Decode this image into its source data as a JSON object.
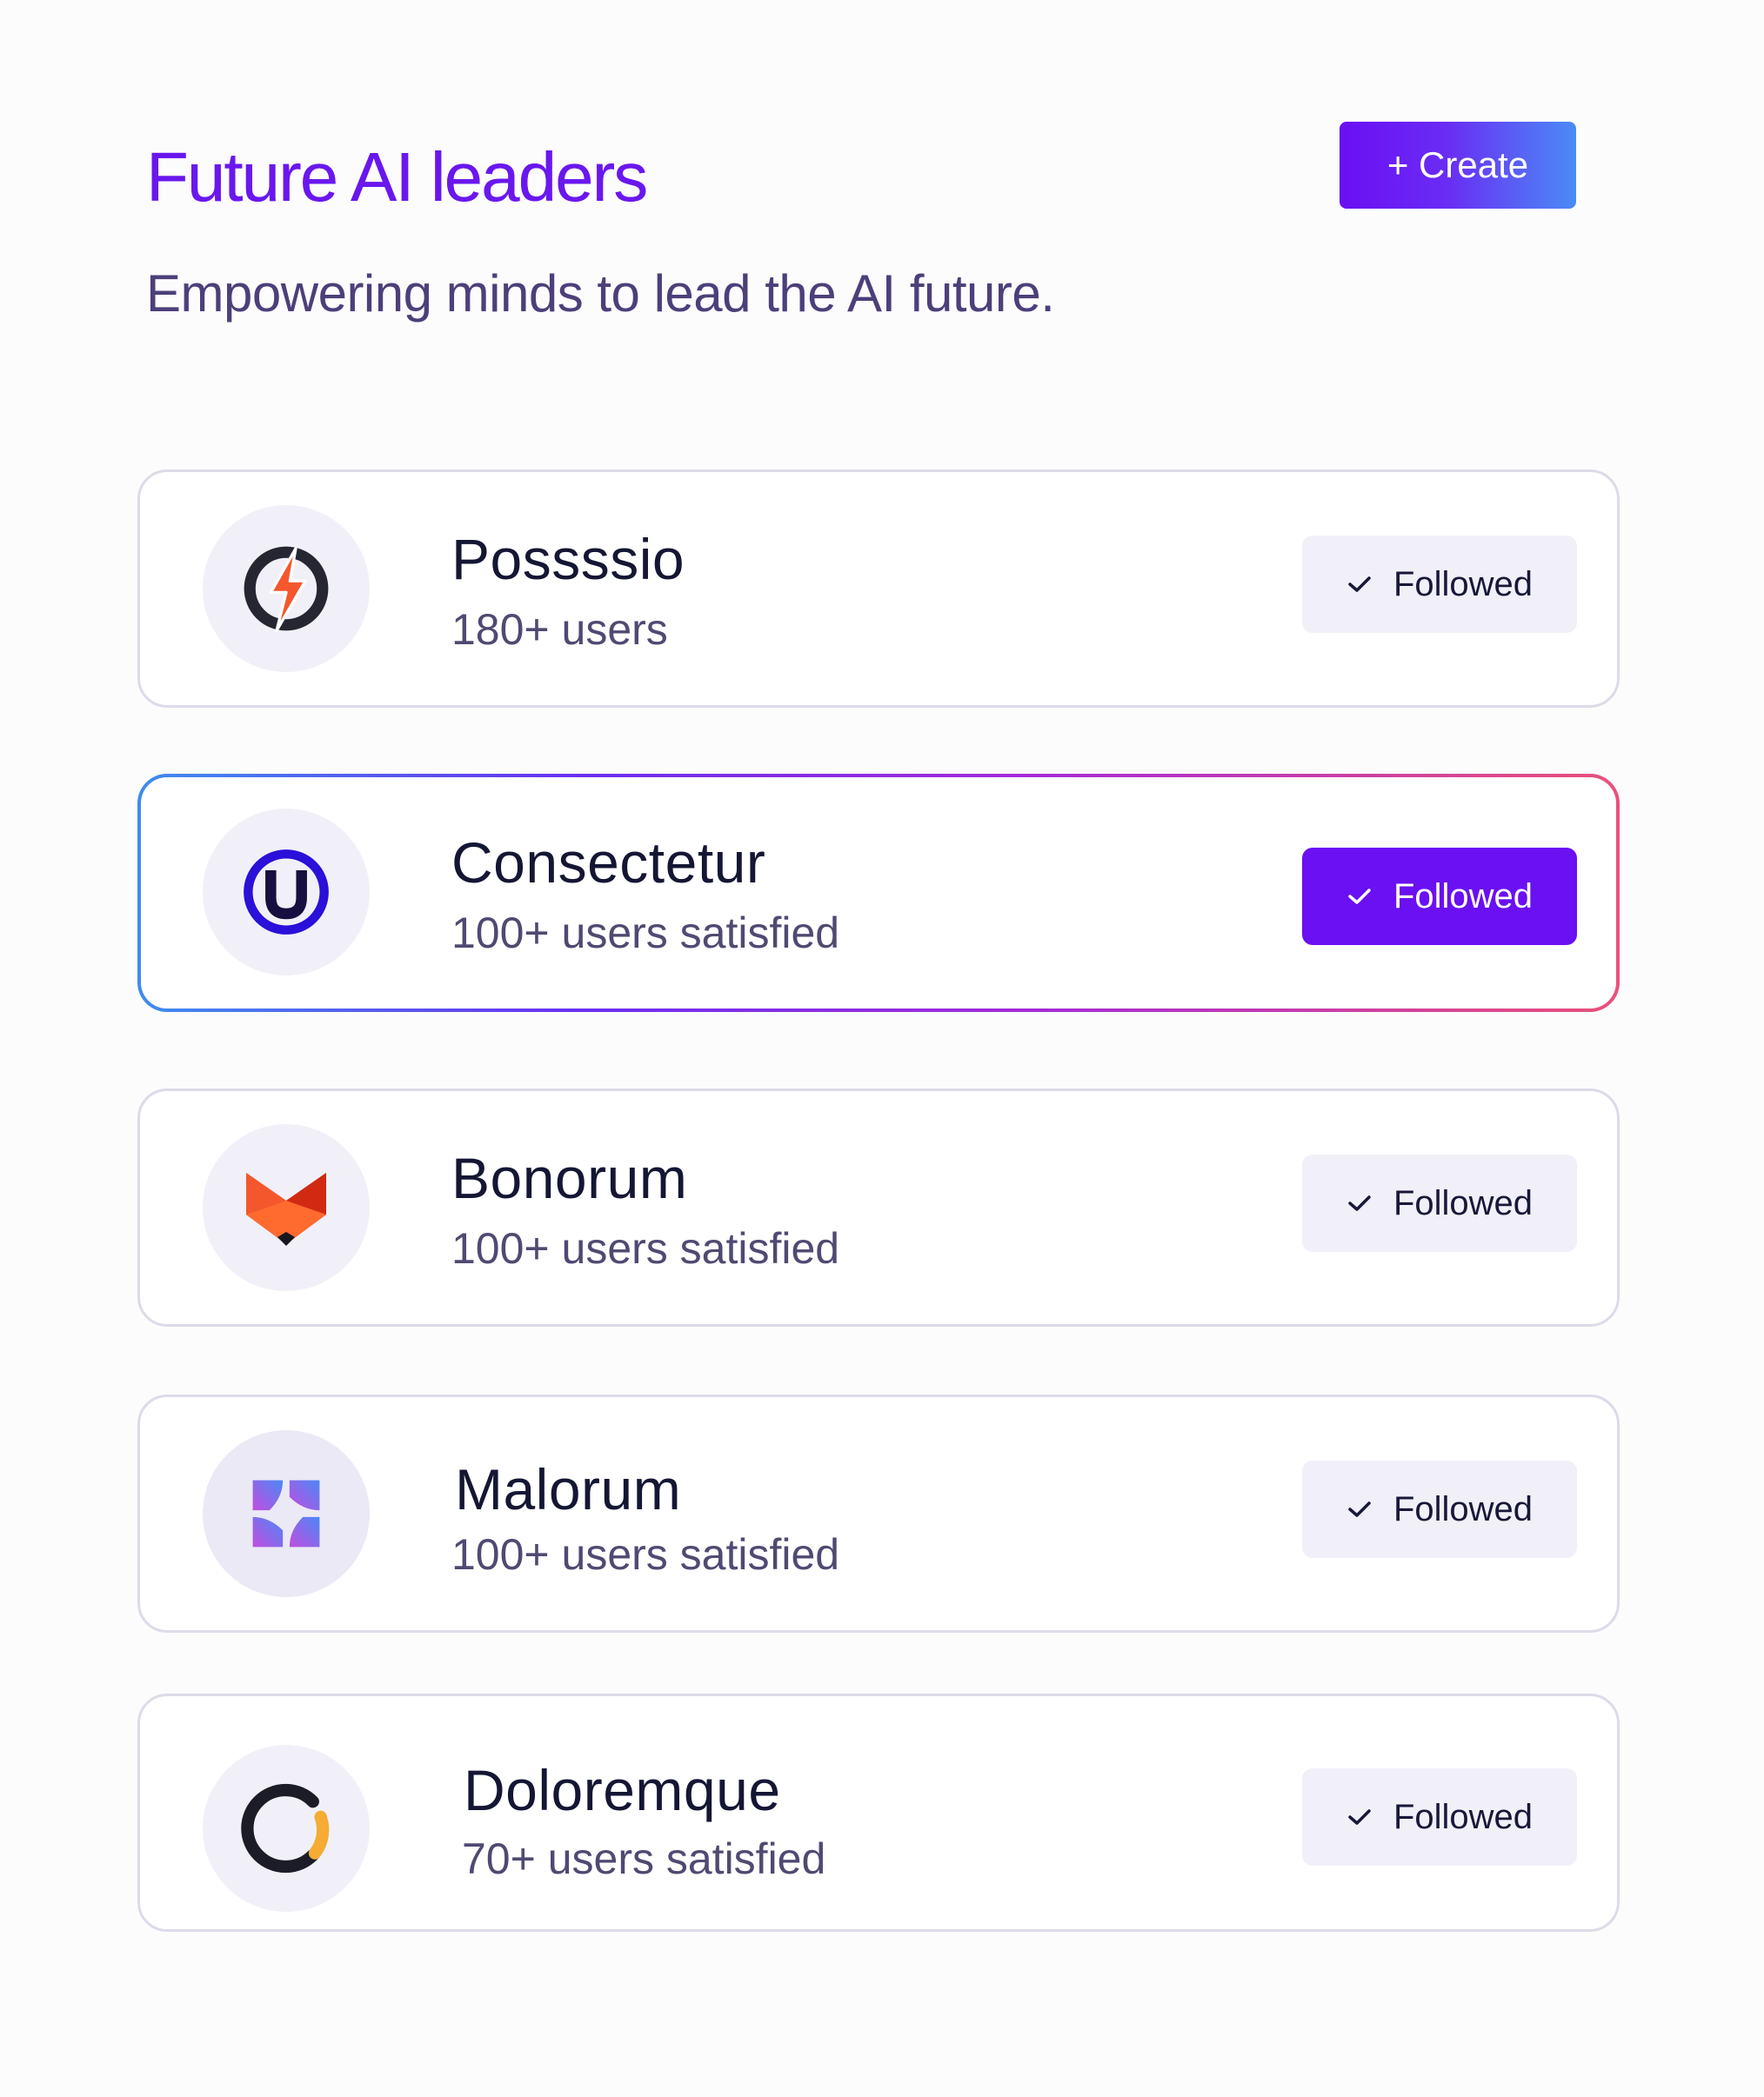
{
  "header": {
    "title": "Future AI leaders",
    "subtitle": "Empowering minds to lead the AI future.",
    "create_label": "+ Create"
  },
  "leaders": [
    {
      "name": "Possssio",
      "meta": "180+ users",
      "follow_label": "Followed",
      "logo": "lightning-ring-icon",
      "highlighted": false
    },
    {
      "name": "Consectetur",
      "meta": "100+ users satisfied",
      "follow_label": "Followed",
      "logo": "u-ring-icon",
      "highlighted": true
    },
    {
      "name": "Bonorum",
      "meta": "100+ users satisfied",
      "follow_label": "Followed",
      "logo": "fox-icon",
      "highlighted": false
    },
    {
      "name": "Malorum",
      "meta": "100+ users satisfied",
      "follow_label": "Followed",
      "logo": "pinwheel-icon",
      "highlighted": false
    },
    {
      "name": "Doloremque",
      "meta": "70+ users satisfied",
      "follow_label": "Followed",
      "logo": "ring-arc-icon",
      "highlighted": false
    }
  ],
  "colors": {
    "accent": "#6a10f2",
    "title": "#6a17ee",
    "text": "#141634",
    "muted": "#4f4a72",
    "card_border": "#dcdbe9",
    "chip_bg": "#f1f0f8"
  }
}
